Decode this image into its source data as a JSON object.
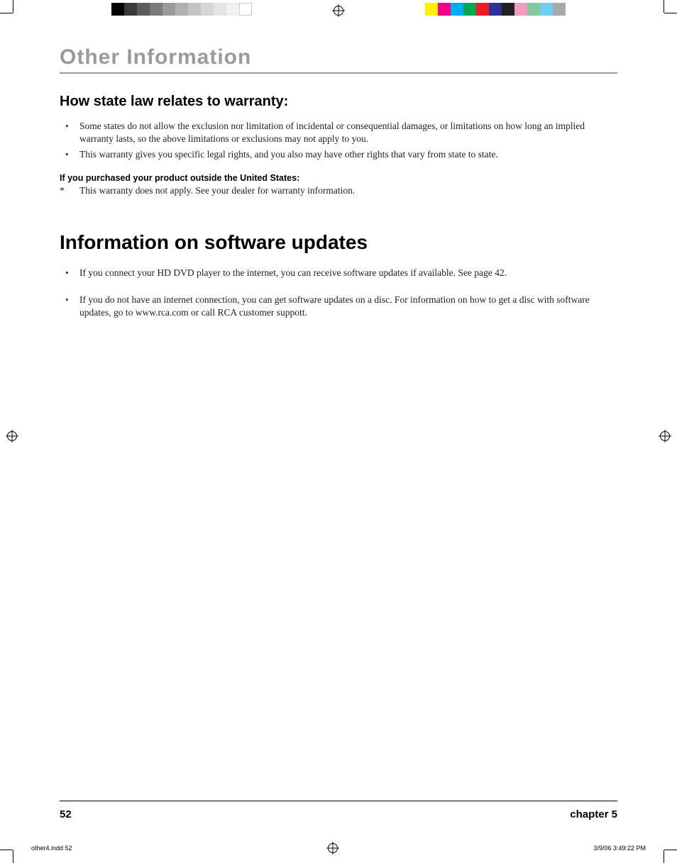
{
  "section_title": "Other Information",
  "warranty": {
    "heading": "How state law relates to warranty:",
    "bullets": [
      "Some states do not allow the exclusion nor limitation of incidental or consequential damages, or limitations on how long an implied warranty lasts, so the above limitations or exclusions may not apply to you.",
      "This warranty gives you specific legal rights, and you also may have other rights that vary from state to state."
    ],
    "outside_us_label": "If you purchased your product outside the United States:",
    "outside_us_note": "This warranty does not apply. See your dealer for warranty information."
  },
  "updates": {
    "heading": "Information on software updates",
    "bullets": [
      "If you connect your HD DVD player to the internet, you can receive software updates if available. See page 42.",
      "If you do not have an internet connection, you can get software updates on a disc. For information on how to get a disc with software updates, go to www.rca.com or call RCA customer suppott."
    ]
  },
  "footer": {
    "page": "52",
    "chapter": "chapter 5"
  },
  "slug": {
    "file": "other4.indd   52",
    "datetime": "3/9/06   3:49:22 PM"
  },
  "colorbars": {
    "left": [
      "#000000",
      "#3a3a3a",
      "#5c5c5c",
      "#7a7a7a",
      "#9a9a9a",
      "#b0b0b0",
      "#c4c4c4",
      "#d6d6d6",
      "#e4e4e4",
      "#f0f0f0",
      "#ffffff"
    ],
    "right": [
      "#fff200",
      "#ec008c",
      "#00aeef",
      "#00a651",
      "#ed1c24",
      "#2e3192",
      "#231f20",
      "#f49ac1",
      "#82ca9c",
      "#6dcff6",
      "#a7a9ac"
    ]
  }
}
